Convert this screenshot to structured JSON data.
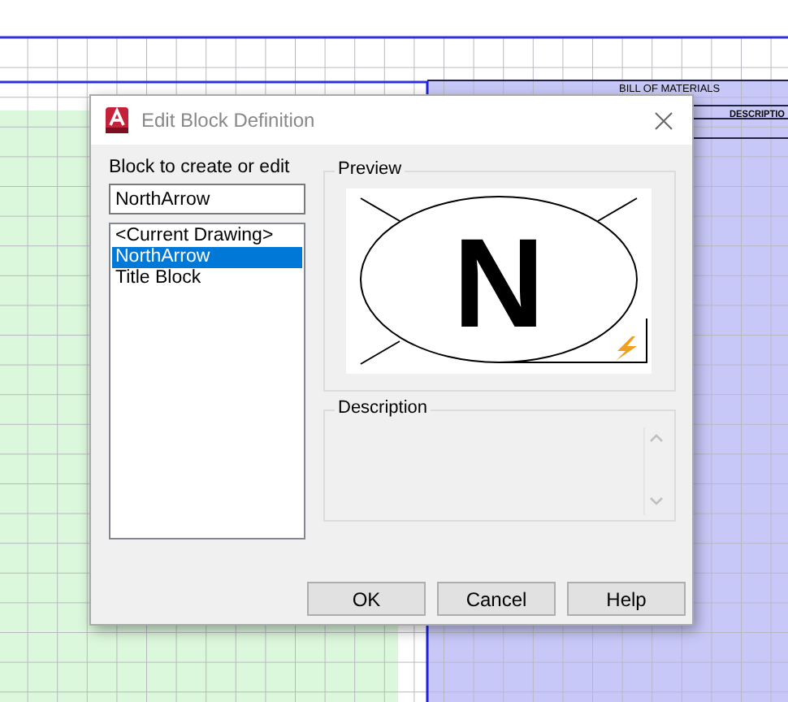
{
  "drawing": {
    "table_title": "BILL OF MATERIALS",
    "table_column": "DESCRIPTIO"
  },
  "window": {
    "title": "Edit Block Definition"
  },
  "block_field": {
    "label": "Block to create or edit",
    "value": "NorthArrow"
  },
  "blocks": [
    {
      "label": "<Current Drawing>",
      "selected": false
    },
    {
      "label": "NorthArrow",
      "selected": true
    },
    {
      "label": "Title Block",
      "selected": false
    }
  ],
  "preview": {
    "title": "Preview",
    "glyph": "N"
  },
  "description": {
    "title": "Description"
  },
  "buttons": [
    "OK",
    "Cancel",
    "Help"
  ]
}
